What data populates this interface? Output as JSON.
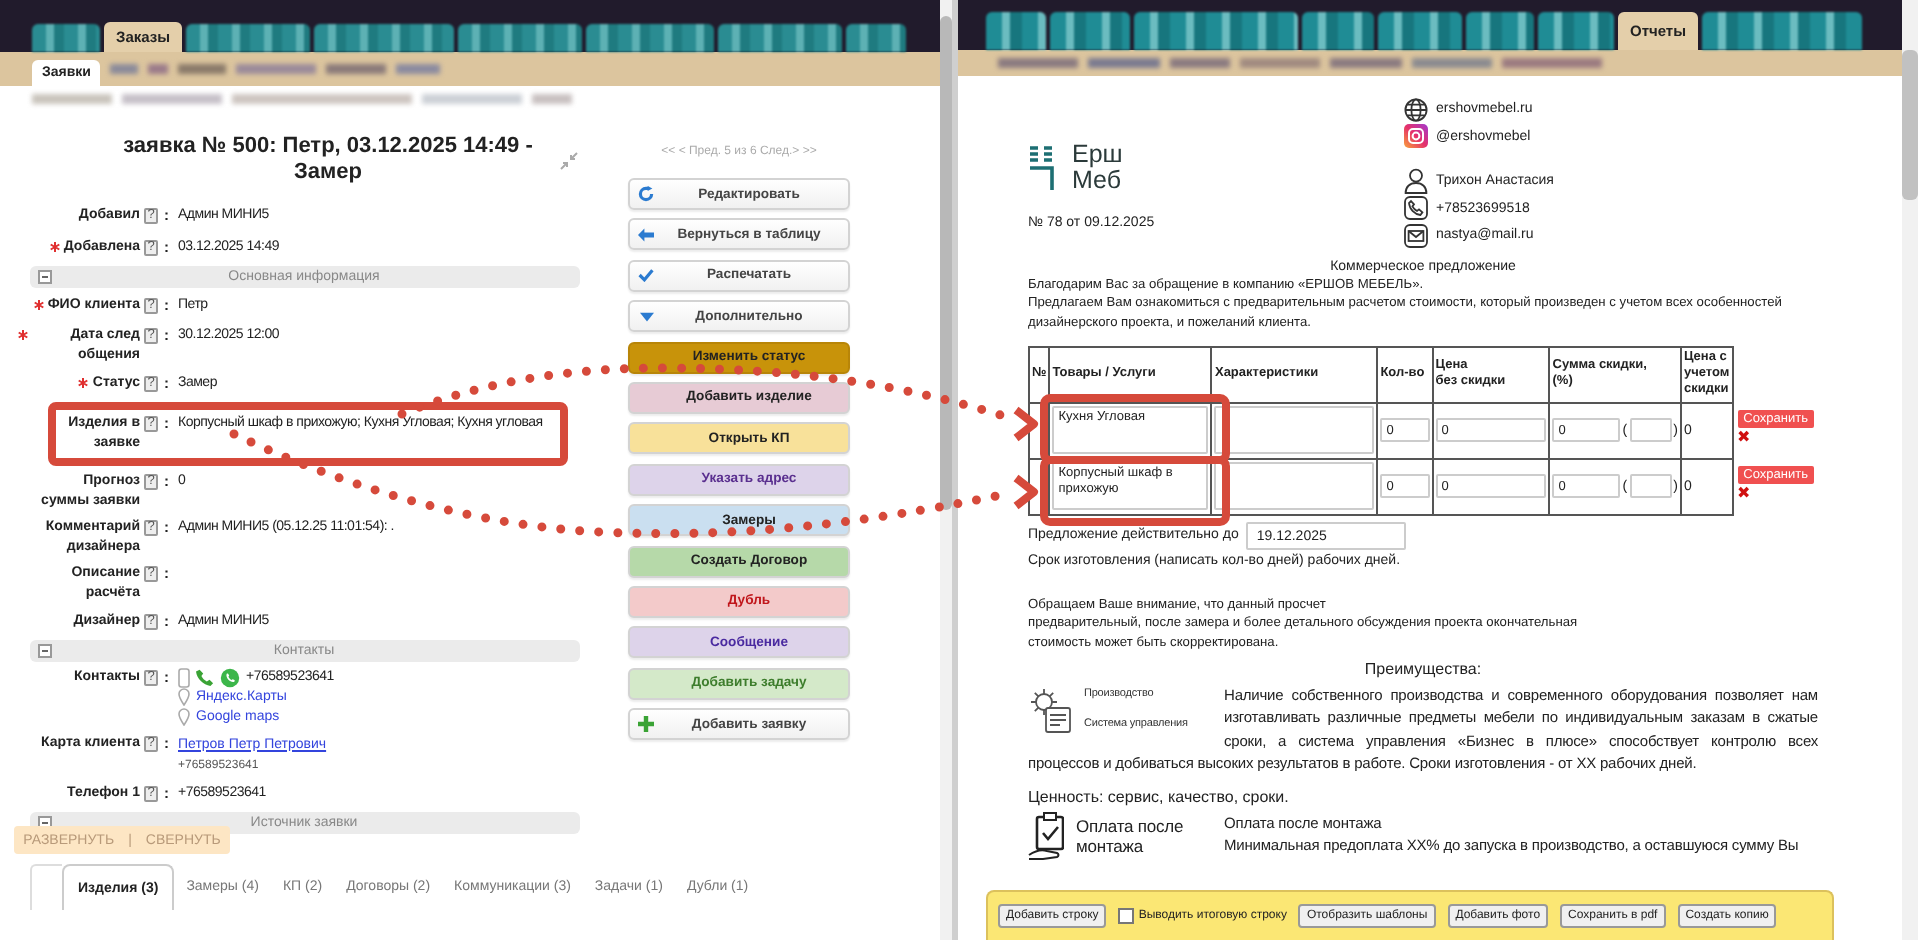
{
  "left": {
    "tabs": [
      {
        "label": "Заказы",
        "selected": true
      }
    ],
    "subtabs": [
      {
        "label": "Заявки",
        "selected": true
      }
    ],
    "title": "заявка № 500: Петр, 03.12.2025 14:49 - Замер",
    "pager": "<< < Пред. 5 из 6 След.> >>",
    "rows": [
      {
        "kind": "field",
        "label": "Добавил",
        "required": false,
        "help": "?",
        "colon": ":",
        "value": "Админ МИНИ5"
      },
      {
        "kind": "field",
        "label": "Добавлена",
        "required": true,
        "help": "?",
        "colon": ":",
        "value": "03.12.2025 14:49"
      },
      {
        "kind": "section",
        "label": "Основная информация",
        "expanded": true
      },
      {
        "kind": "field",
        "label": "ФИО клиента",
        "required": true,
        "help": "?",
        "colon": ":",
        "value": "Петр"
      },
      {
        "kind": "field",
        "label": "Дата след общения",
        "required": true,
        "help": "?",
        "colon": ":",
        "value": "30.12.2025 12:00"
      },
      {
        "kind": "field",
        "label": "Статус",
        "required": true,
        "help": "?",
        "colon": ":",
        "value": "Замер"
      },
      {
        "kind": "field",
        "label": "Изделия в заявке",
        "required": false,
        "highlighted": true,
        "help": "?",
        "colon": ":",
        "value": "Корпусный шкаф в прихожую; Кухня Угловая; Кухня угловая"
      },
      {
        "kind": "field",
        "label": "Прогноз суммы заявки",
        "required": false,
        "help": "?",
        "colon": ":",
        "value": "0"
      },
      {
        "kind": "field",
        "label": "Комментарий дизайнера",
        "required": false,
        "help": "?",
        "colon": ":",
        "value": "Админ МИНИ5 (05.12.25 11:01:54): ."
      },
      {
        "kind": "field",
        "label": "Описание расчёта",
        "required": false,
        "help": "?",
        "colon": ":"
      },
      {
        "kind": "field",
        "label": "Дизайнер",
        "required": false,
        "help": "?",
        "colon": ":",
        "value": "Админ МИНИ5"
      },
      {
        "kind": "section",
        "label": "Контакты",
        "expanded": true
      },
      {
        "kind": "contacts",
        "label": "Контакты",
        "required": false,
        "help": "?",
        "colon": ":",
        "phone": "+76589523641",
        "links": [
          "Яндекс.Карты",
          "Google maps"
        ]
      },
      {
        "kind": "client",
        "label": "Карта клиента",
        "required": false,
        "help": "?",
        "colon": ":",
        "link": "Петров Петр Петрович",
        "value": "+76589523641"
      },
      {
        "kind": "field",
        "label": "Телефон 1",
        "required": false,
        "help": "?",
        "colon": ":",
        "value": "+76589523641"
      },
      {
        "kind": "section",
        "label": "Источник заявки",
        "expanded": true
      }
    ],
    "actions": [
      {
        "label": "Редактировать"
      },
      {
        "label": "Вернуться в таблицу"
      },
      {
        "label": "Распечатать"
      },
      {
        "label": "Дополнительно"
      },
      {
        "label": "Изменить статус"
      },
      {
        "label": "Добавить изделие"
      },
      {
        "label": "Открыть КП"
      },
      {
        "label": "Указать адрес"
      },
      {
        "label": "Замеры"
      },
      {
        "label": "Создать Договор"
      },
      {
        "label": "Дубль"
      },
      {
        "label": "Сообщение"
      },
      {
        "label": "Добавить задачу"
      },
      {
        "label": "Добавить заявку"
      }
    ],
    "expand_bar": {
      "links": [
        "РАЗВЕРНУТЬ",
        "СВЕРНУТЬ"
      ],
      "separator": "|"
    },
    "bottom_tabs": [
      {
        "label": "Изделия (3)",
        "selected": true
      },
      {
        "label": "Замеры (4)",
        "selected": false
      },
      {
        "label": "КП (2)",
        "selected": false
      },
      {
        "label": "Договоры (2)",
        "selected": false
      },
      {
        "label": "Коммуникации (3)",
        "selected": false
      },
      {
        "label": "Задачи (1)",
        "selected": false
      },
      {
        "label": "Дубли (1)",
        "selected": false
      }
    ]
  },
  "right": {
    "tabs": [
      {
        "label": "Отчеты",
        "selected": true
      }
    ],
    "logo": [
      "Ерш",
      "Меб"
    ],
    "contacts": [
      {
        "kind": "web",
        "text": "ershovmebel.ru"
      },
      {
        "kind": "instagram",
        "text": "@ershovmebel"
      },
      {
        "kind": "person",
        "text": "Трихон Анастасия"
      },
      {
        "kind": "phone",
        "text": "+78523699518"
      },
      {
        "kind": "email",
        "text": "nastya@mail.ru"
      }
    ],
    "doc_number": "№ 78 от 09.12.2025",
    "heading": "Коммерческое предложение",
    "intro": [
      "Благодарим Вас за обращение в компанию «ЕРШОВ МЕБЕЛЬ».",
      "Предлагаем Вам ознакомиться с предварительным расчетом стоимости, который произведен с учетом всех особенностей",
      "дизайнерского проекта, и пожеланий клиента."
    ],
    "table": {
      "columns": [
        "№",
        "Товары / Услуги",
        "Характеристики",
        "Кол-во",
        "Цена\nбез скидки",
        "Сумма скидки,\n(%)",
        "Цена с учетом скидки"
      ],
      "rows": [
        {
          "product": "Кухня Угловая",
          "qty": "0",
          "price": "0",
          "discount": "0",
          "paren_open": "(",
          "paren_close": ")",
          "total": "0",
          "save": "Сохранить",
          "delete": "✖"
        },
        {
          "product": "Корпусный шкаф в прихожую",
          "qty": "0",
          "price": "0",
          "discount": "0",
          "paren_open": "(",
          "paren_close": ")",
          "total": "0",
          "save": "Сохранить",
          "delete": "✖"
        }
      ]
    },
    "valid_until": {
      "label": "Предложение действительно до",
      "value": "19.12.2025"
    },
    "term": "Срок изготовления (написать кол-во дней) рабочих дней.",
    "notice": [
      "Обращаем Ваше внимание, что данный просчет",
      "предварительный, после замера и более детального обсуждения проекта окончательная",
      "стоимость может быть скорректирована."
    ],
    "advantages_title": "Преимущества:",
    "features": [
      {
        "kind": "gears",
        "labels": [
          "Производство",
          "Система управления"
        ],
        "text": [
          "Наличие собственного производства и современного оборудования позволяет нам изготавливать различные предметы мебели по индивидуальным заказам в сжатые сроки, а система управления «Бизнес в плюсе» способствует контролю всех",
          "процессов и добиваться высоких результатов в работе. Сроки изготовления - от ХХ рабочих дней."
        ]
      },
      {
        "kind": "clipboard",
        "labels": [
          "Оплата после монтажа"
        ],
        "text": [
          "Оплата после монтажа",
          "Минимальная предоплата ХХ% до запуска в производство, а оставшуюся сумму Вы"
        ]
      }
    ],
    "value_line": "Ценность: сервис, качество, сроки.",
    "toolbar": [
      {
        "kind": "button",
        "label": "Добавить строку"
      },
      {
        "kind": "checkbox",
        "label": "Выводить итоговую строку",
        "checked": false
      },
      {
        "kind": "button",
        "label": "Отобразить шаблоны"
      },
      {
        "kind": "button",
        "label": "Добавить фото"
      },
      {
        "kind": "button",
        "label": "Сохранить в pdf"
      },
      {
        "kind": "button",
        "label": "Создать копию"
      }
    ]
  }
}
